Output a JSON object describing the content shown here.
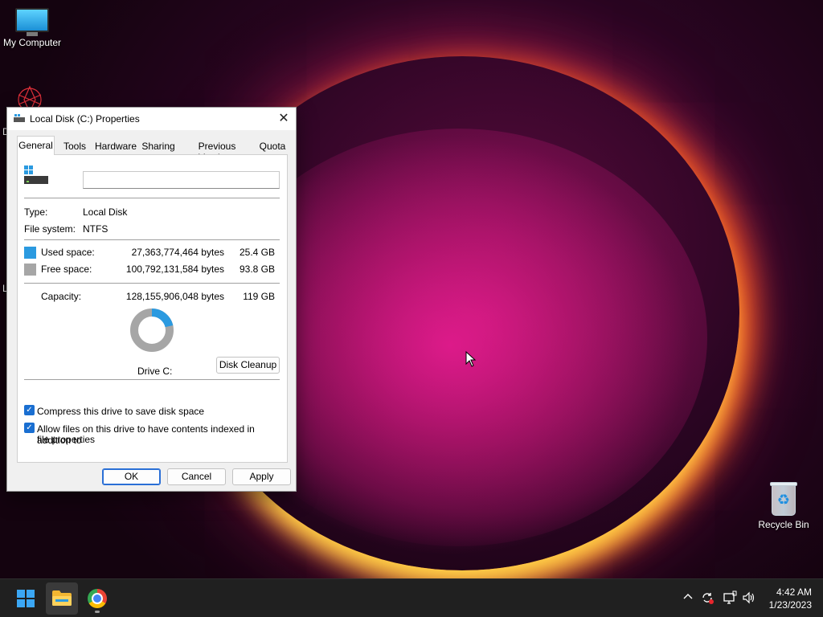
{
  "desktop": {
    "icons": {
      "my_computer": "My Computer",
      "recycle_bin": "Recycle Bin",
      "partial_d": "D",
      "partial_l": "L"
    }
  },
  "dialog": {
    "title": "Local Disk (C:) Properties",
    "tabs": [
      "General",
      "Tools",
      "Hardware",
      "Sharing",
      "Previous Versions",
      "Quota"
    ],
    "active_tab": "General",
    "label_value": "",
    "type_label": "Type:",
    "type_value": "Local Disk",
    "fs_label": "File system:",
    "fs_value": "NTFS",
    "used_label": "Used space:",
    "used_bytes": "27,363,774,464 bytes",
    "used_gb": "25.4 GB",
    "free_label": "Free space:",
    "free_bytes": "100,792,131,584 bytes",
    "free_gb": "93.8 GB",
    "capacity_label": "Capacity:",
    "capacity_bytes": "128,155,906,048 bytes",
    "capacity_gb": "119 GB",
    "used_fraction": 0.2135,
    "drive_label": "Drive C:",
    "disk_cleanup": "Disk Cleanup",
    "compress_label": "Compress this drive to save disk space",
    "compress_checked": true,
    "index_label_1": "Allow files on this drive to have contents indexed in addition to",
    "index_label_2": "file properties",
    "index_checked": true,
    "ok": "OK",
    "cancel": "Cancel",
    "apply": "Apply",
    "colors": {
      "used": "#2b9ae0",
      "free": "#a6a6a6",
      "accent": "#1a6fd1"
    }
  },
  "taskbar": {
    "time": "4:42 AM",
    "date": "1/23/2023",
    "apps": [
      "start",
      "file-explorer",
      "chrome"
    ]
  }
}
